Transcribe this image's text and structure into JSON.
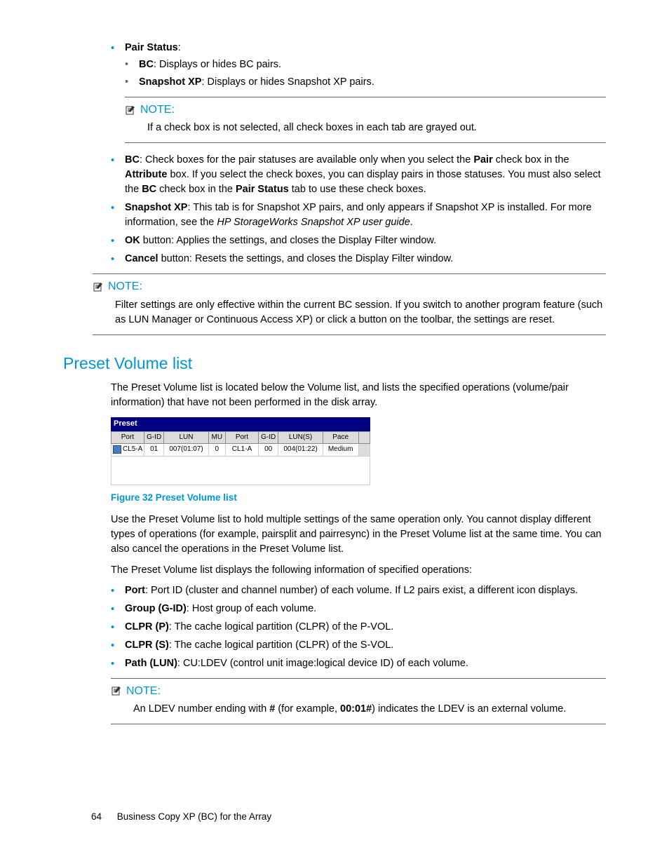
{
  "top_list": [
    {
      "label": "Pair Status",
      "tail": ":",
      "sub": [
        {
          "label": "BC",
          "tail": ": Displays or hides BC pairs."
        },
        {
          "label": "Snapshot XP",
          "tail": ": Displays or hides Snapshot XP pairs."
        }
      ]
    }
  ],
  "note1": {
    "label": "NOTE:",
    "body": "If a check box is not selected, all check boxes in each tab are grayed out."
  },
  "mid_list": {
    "bc": {
      "p1a": "BC",
      "p1b": ": Check boxes for the pair statuses are available only when you select the ",
      "p1c": "Pair",
      "p1d": " check box in the ",
      "p1e": "Attribute",
      "p1f": " box. If you select the check boxes, you can display pairs in those statuses. You must also select the ",
      "p1g": "BC",
      "p1h": " check box in the ",
      "p1i": "Pair Status",
      "p1j": " tab to use these check boxes."
    },
    "sx": {
      "a": "Snapshot XP",
      "b": ": This tab is for Snapshot XP pairs, and only appears if Snapshot XP is installed. For more information, see the ",
      "c": "HP StorageWorks Snapshot XP user guide",
      "d": "."
    },
    "ok": {
      "a": "OK",
      "b": " button: Applies the settings, and closes the Display Filter window."
    },
    "cancel": {
      "a": "Cancel",
      "b": " button: Resets the settings, and closes the Display Filter window."
    }
  },
  "note2": {
    "label": "NOTE:",
    "body": "Filter settings are only effective within the current BC session. If you switch to another program feature (such as LUN Manager or Continuous Access XP) or click a button on the toolbar, the settings are reset."
  },
  "section_title": "Preset Volume list",
  "section_intro": "The Preset Volume list is located below the Volume list, and lists the specified operations (volume/pair information) that have not been performed in the disk array.",
  "preset_table": {
    "title": "Preset",
    "headers": [
      "Port",
      "G-ID",
      "LUN",
      "MU",
      "Port",
      "G-ID",
      "LUN(S)",
      "Pace",
      ""
    ],
    "row": [
      "CL5-A",
      "01",
      "007(01:07)",
      "0",
      "CL1-A",
      "00",
      "004(01:22)",
      "Medium",
      ""
    ]
  },
  "figure_caption": "Figure 32 Preset Volume list",
  "use_para": "Use the Preset Volume list to hold multiple settings of the same operation only. You cannot display different types of operations (for example, pairsplit and pairresync) in the Preset Volume list at the same time. You can also cancel the operations in the Preset Volume list.",
  "displays_para": "The Preset Volume list displays the following information of specified operations:",
  "info_list": [
    {
      "a": "Port",
      "b": ": Port ID (cluster and channel number) of each volume. If L2 pairs exist, a different icon displays."
    },
    {
      "a": "Group (G-ID)",
      "b": ": Host group of each volume."
    },
    {
      "a": "CLPR (P)",
      "b": ": The cache logical partition (CLPR) of the P-VOL."
    },
    {
      "a": "CLPR (S)",
      "b": ": The cache logical partition (CLPR) of the S-VOL."
    },
    {
      "a": "Path (LUN)",
      "b": ": CU:LDEV (control unit image:logical device ID) of each volume."
    }
  ],
  "note3": {
    "label": "NOTE:",
    "pre": "An LDEV number ending with ",
    "hash": "#",
    "mid": " (for example, ",
    "ex": "00:01#",
    "post": ") indicates the LDEV is an external volume."
  },
  "footer": {
    "page": "64",
    "title": "Business Copy XP (BC) for the Array"
  }
}
